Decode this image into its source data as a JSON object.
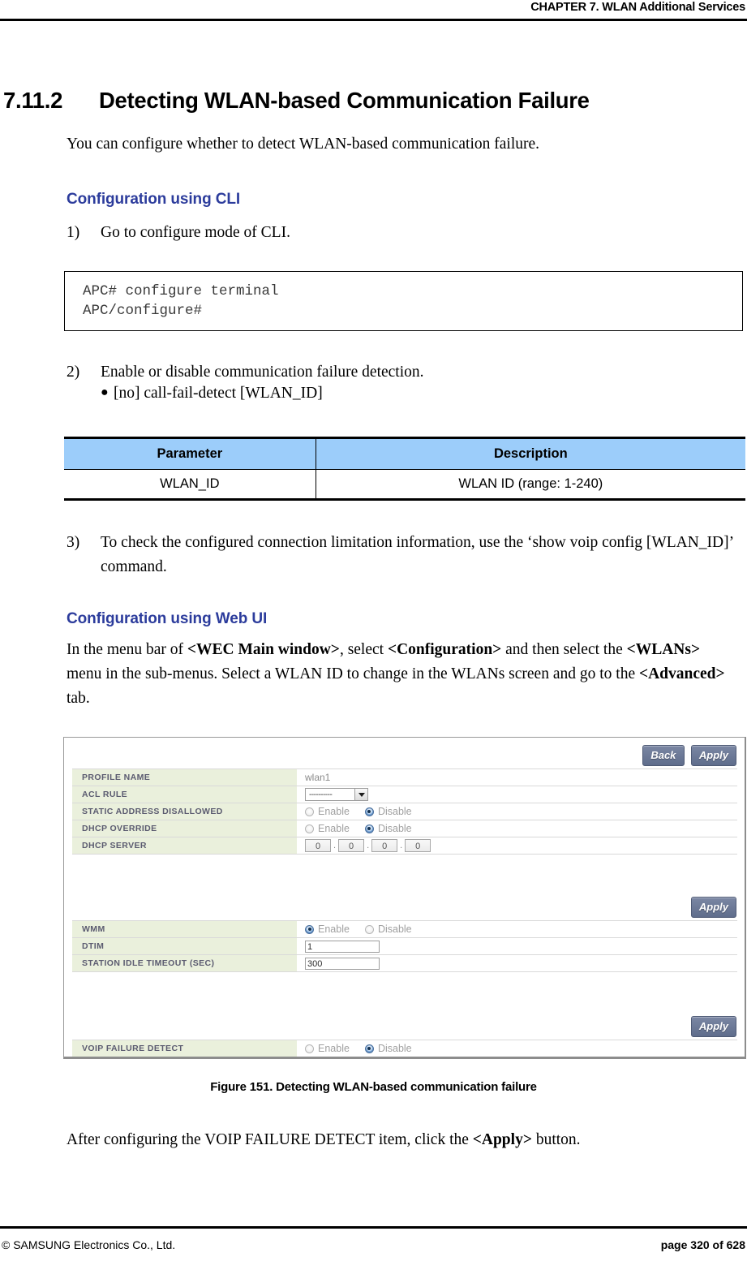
{
  "header": {
    "chapter_title": "CHAPTER 7. WLAN Additional Services"
  },
  "section": {
    "number": "7.11.2",
    "title": "Detecting WLAN-based Communication Failure",
    "intro": "You can configure whether to detect WLAN-based communication failure."
  },
  "cli": {
    "heading": "Configuration using CLI",
    "step1_num": "1)",
    "step1_text": "Go to configure mode of CLI.",
    "console_text": "APC# configure terminal\nAPC/configure#",
    "step2_num": "2)",
    "step2_text": "Enable or disable communication failure detection.",
    "bullet_command": "[no] call-fail-detect [WLAN_ID]",
    "step3_num": "3)",
    "step3_text": "To check the configured connection limitation information, use the ‘show voip config [WLAN_ID]’ command."
  },
  "param_table": {
    "headers": [
      "Parameter",
      "Description"
    ],
    "rows": [
      [
        "WLAN_ID",
        "WLAN ID (range: 1-240)"
      ]
    ],
    "header_bg": "#9ccdfa"
  },
  "webui": {
    "heading": "Configuration using Web UI",
    "paragraph_html": "In the menu bar of <b>&lt;WEC Main window&gt;</b>, select <b>&lt;Configuration&gt;</b> and then select the <b>&lt;WLANs&gt;</b> menu in the sub-menus. Select a WLAN ID to change in the WLANs screen and go to the <b>&lt;Advanced&gt;</b> tab."
  },
  "figure": {
    "caption": "Figure 151. Detecting WLAN-based communication failure",
    "buttons": {
      "back": "Back",
      "apply": "Apply"
    },
    "group1": {
      "rows": [
        {
          "label": "PROFILE NAME",
          "type": "text-static",
          "value": "wlan1"
        },
        {
          "label": "ACL RULE",
          "type": "select",
          "value": "----------"
        },
        {
          "label": "STATIC ADDRESS DISALLOWED",
          "type": "radio",
          "options": [
            "Enable",
            "Disable"
          ],
          "selected": "Disable"
        },
        {
          "label": "DHCP OVERRIDE",
          "type": "radio",
          "options": [
            "Enable",
            "Disable"
          ],
          "selected": "Disable"
        },
        {
          "label": "DHCP SERVER",
          "type": "ip",
          "value": [
            "0",
            "0",
            "0",
            "0"
          ]
        }
      ]
    },
    "group2": {
      "rows": [
        {
          "label": "WMM",
          "type": "radio",
          "options": [
            "Enable",
            "Disable"
          ],
          "selected": "Enable"
        },
        {
          "label": "DTIM",
          "type": "input",
          "value": "1"
        },
        {
          "label": "STATION IDLE TIMEOUT (SEC)",
          "type": "input",
          "value": "300"
        }
      ]
    },
    "group3": {
      "rows": [
        {
          "label": "VOIP FAILURE DETECT",
          "type": "radio",
          "options": [
            "Enable",
            "Disable"
          ],
          "selected": "Disable"
        }
      ]
    }
  },
  "closing": {
    "paragraph_html": "After configuring the VOIP FAILURE DETECT item, click the <b>&lt;Apply&gt;</b> button."
  },
  "footer": {
    "left": "© SAMSUNG Electronics Co., Ltd.",
    "right": "page 320 of 628"
  }
}
